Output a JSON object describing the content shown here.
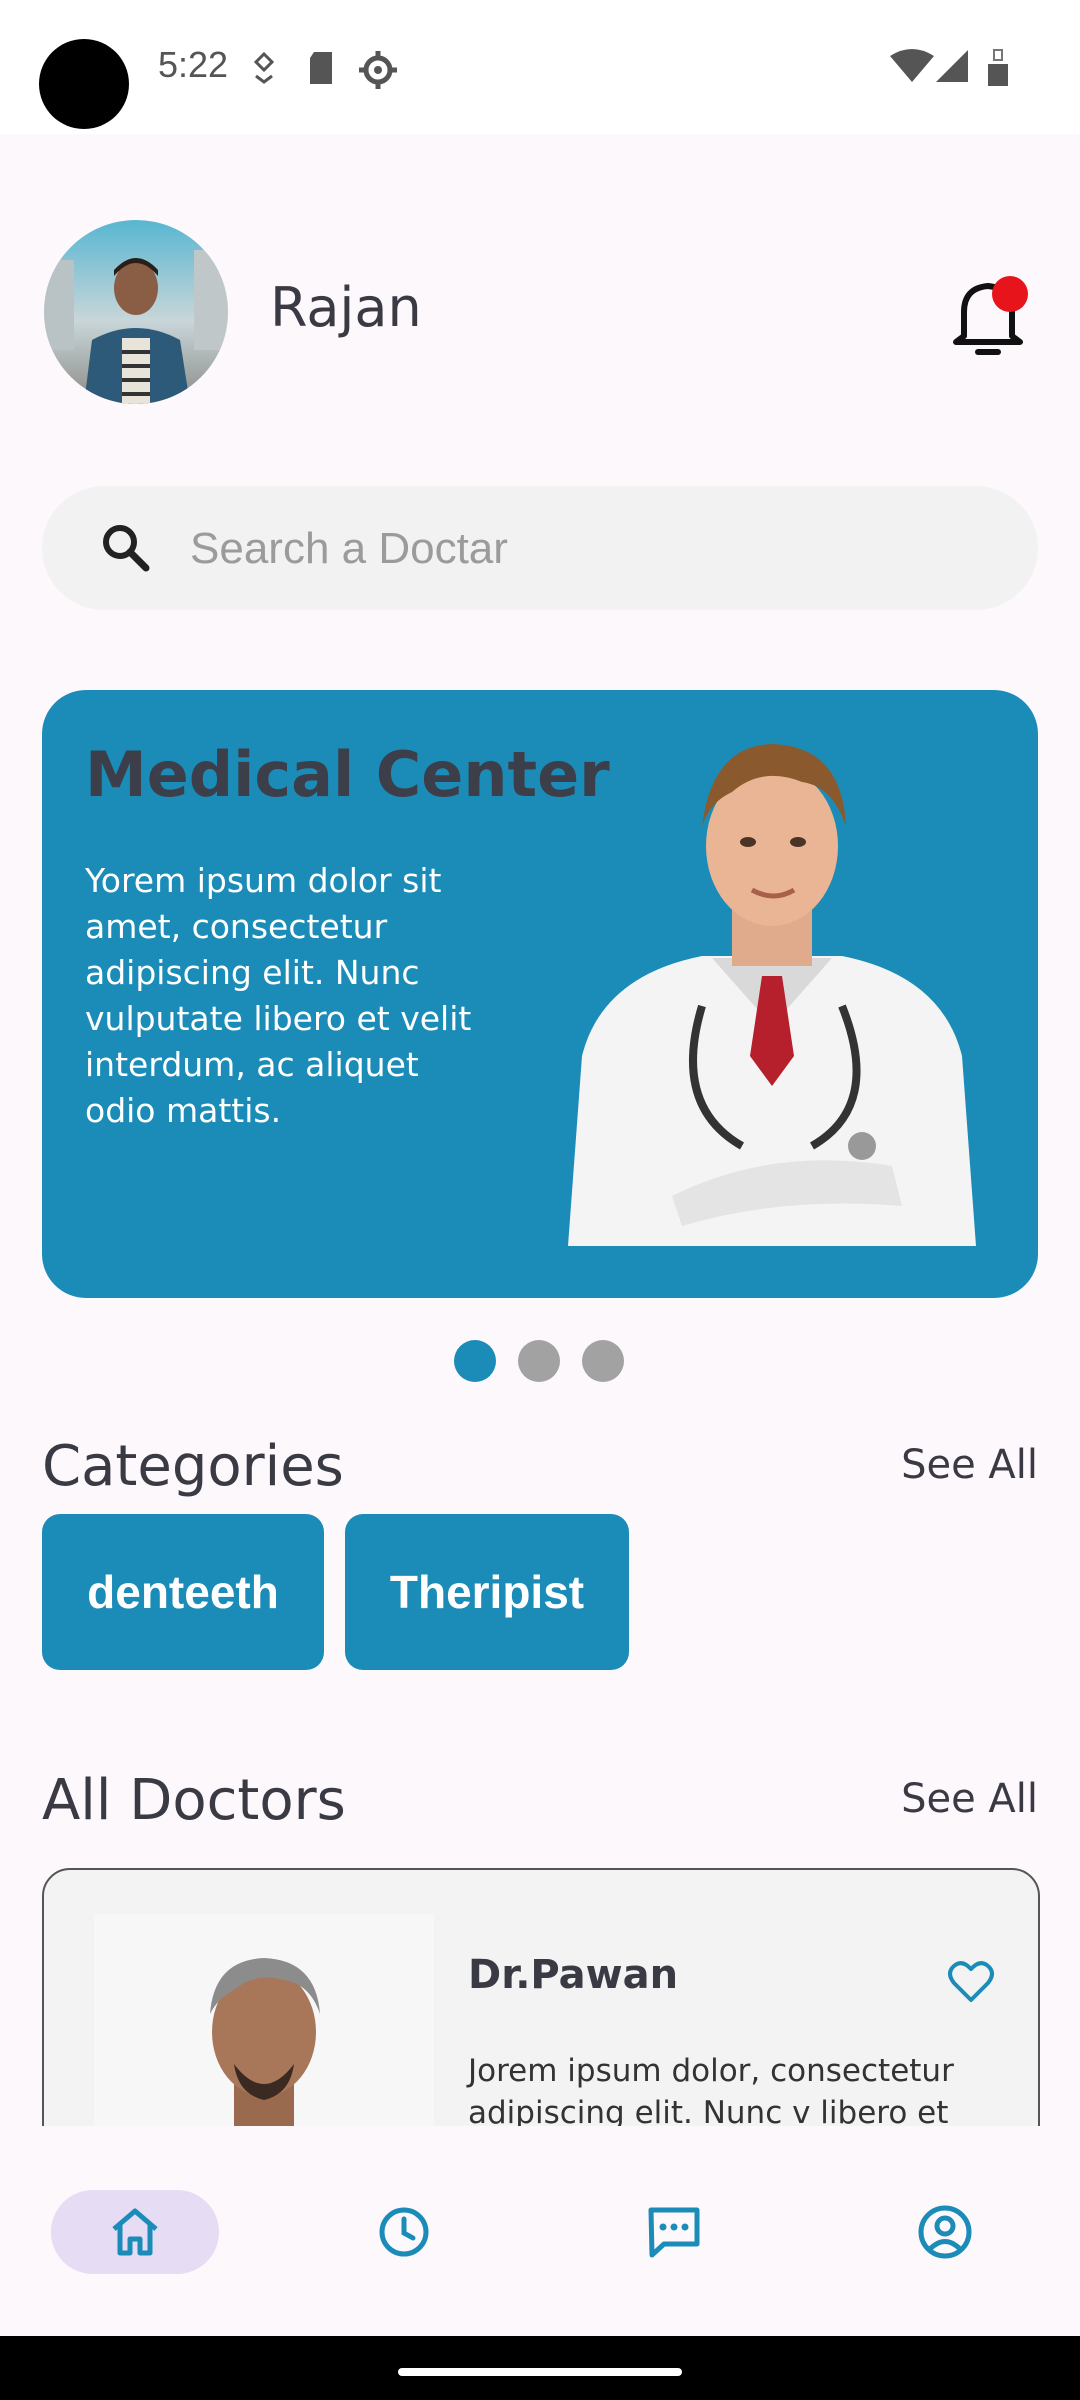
{
  "status_bar": {
    "time": "5:22",
    "icons": [
      "location-icon",
      "sd-card-icon",
      "settings-icon",
      "wifi-icon",
      "cell-signal-icon",
      "battery-icon"
    ]
  },
  "header": {
    "user_name": "Rajan",
    "notification_badge_color": "#e8141c"
  },
  "search": {
    "placeholder": "Search a Doctar"
  },
  "banner": {
    "title": "Medical Center",
    "text": "Yorem ipsum dolor sit amet, consectetur adipiscing elit. Nunc vulputate libero et velit interdum, ac aliquet odio mattis.",
    "background_color": "#1b8cb8",
    "pager": {
      "count": 3,
      "active_index": 0
    }
  },
  "categories": {
    "title": "Categories",
    "see_all": "See All",
    "items": [
      {
        "label": "denteeth"
      },
      {
        "label": "Theripist"
      }
    ]
  },
  "doctors": {
    "title": "All Doctors",
    "see_all": "See All",
    "items": [
      {
        "name": "Dr.Pawan",
        "description": "Jorem ipsum dolor, consectetur adipiscing elit. Nunc v libero et"
      }
    ]
  },
  "bottom_nav": {
    "items": [
      {
        "icon": "home-icon",
        "active": true
      },
      {
        "icon": "history-clock-icon",
        "active": false
      },
      {
        "icon": "chat-icon",
        "active": false
      },
      {
        "icon": "profile-icon",
        "active": false
      }
    ],
    "accent_color": "#1b8cb8",
    "active_pill_color": "#e6dcf4"
  }
}
